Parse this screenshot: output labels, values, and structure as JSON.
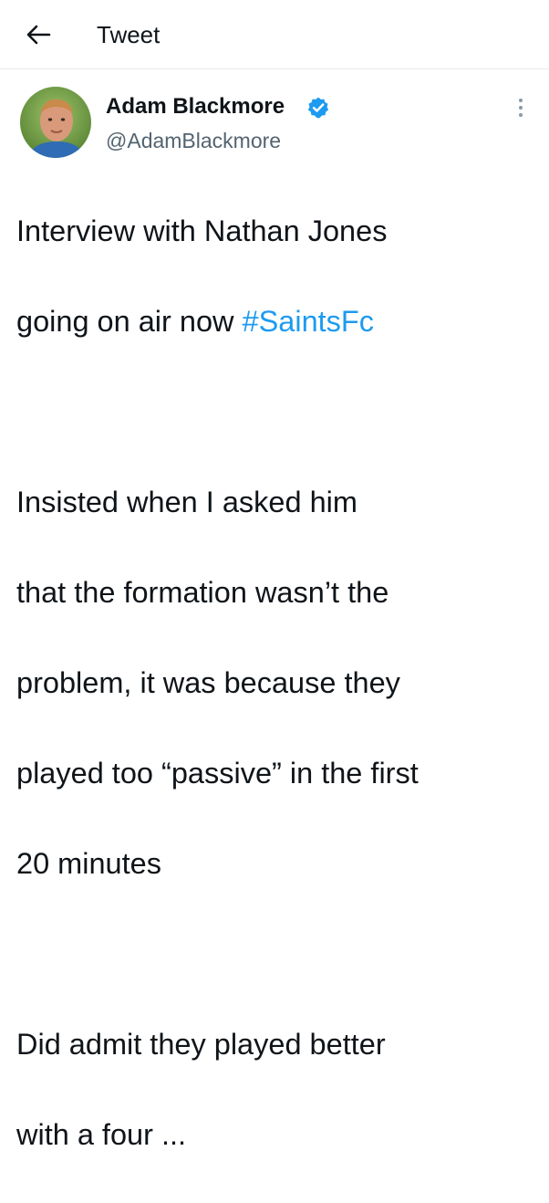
{
  "header": {
    "back_icon": "arrow-left-icon",
    "title": "Tweet"
  },
  "tweet": {
    "author": {
      "name": "Adam Blackmore",
      "handle": "@AdamBlackmore",
      "verified_icon": "verified-badge-icon",
      "avatar_icon": "avatar-photo"
    },
    "more_icon": "more-vertical-icon",
    "body": {
      "line1": "Interview with Nathan Jones",
      "line2_text": "going on air now ",
      "hashtag": "#SaintsFc",
      "paragraph2": [
        "Insisted when I asked him",
        "that the formation wasn’t the",
        "problem, it was because they",
        "played too “passive” in the first",
        "20 minutes"
      ],
      "paragraph3": [
        "Did admit they played better",
        "with a four ..."
      ]
    }
  },
  "colors": {
    "accent": "#1d9bf0",
    "text": "#0f1419",
    "secondary": "#536471",
    "divider": "#e6e8ea"
  }
}
